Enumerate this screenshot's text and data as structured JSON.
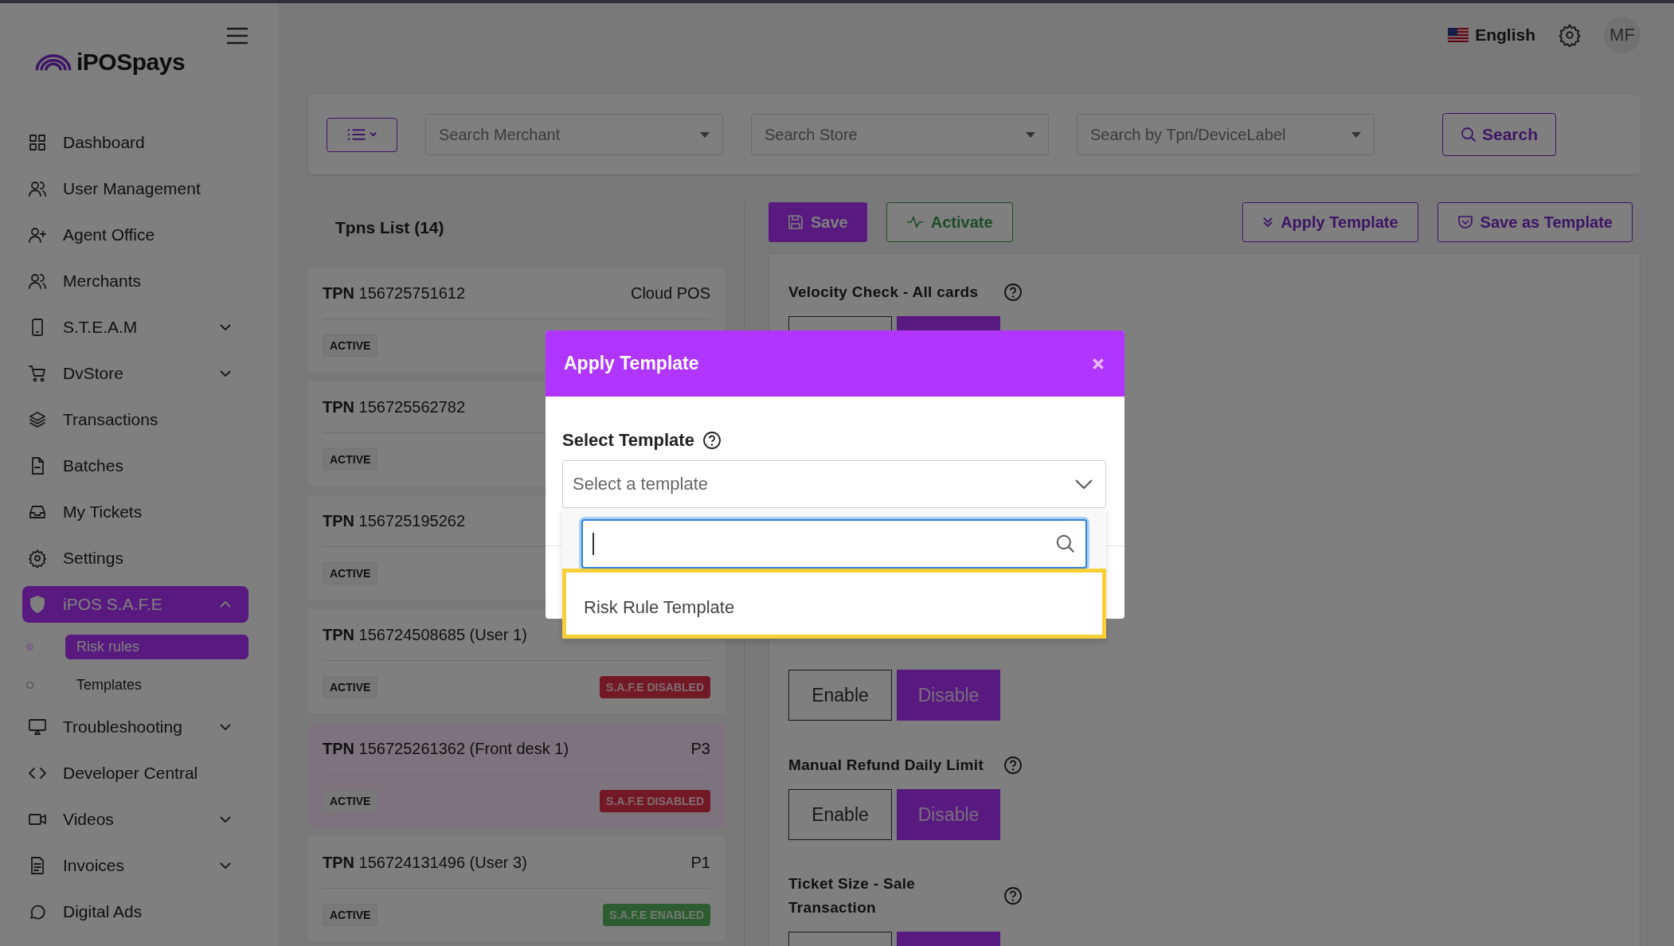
{
  "brand": {
    "name": "iPOSpays"
  },
  "header": {
    "language": "English",
    "avatar": "MF"
  },
  "sidebar": {
    "items": [
      {
        "label": "Dashboard",
        "selected": false
      },
      {
        "label": "User Management",
        "selected": false
      },
      {
        "label": "Agent Office",
        "selected": false
      },
      {
        "label": "Merchants",
        "selected": false
      },
      {
        "label": "S.T.E.A.M",
        "expanded": false,
        "selected": false
      },
      {
        "label": "DvStore",
        "expanded": false,
        "selected": false
      },
      {
        "label": "Transactions",
        "selected": false
      },
      {
        "label": "Batches",
        "selected": false
      },
      {
        "label": "My Tickets",
        "selected": false
      },
      {
        "label": "Settings",
        "selected": false
      },
      {
        "label": "iPOS S.A.F.E",
        "expanded": true,
        "selected": true,
        "children": [
          {
            "label": "Risk rules",
            "selected": true
          },
          {
            "label": "Templates",
            "selected": false
          }
        ]
      },
      {
        "label": "Troubleshooting",
        "expanded": false,
        "selected": false
      },
      {
        "label": "Developer Central",
        "selected": false
      },
      {
        "label": "Videos",
        "expanded": false,
        "selected": false
      },
      {
        "label": "Invoices",
        "expanded": false,
        "selected": false
      },
      {
        "label": "Digital Ads",
        "selected": false
      }
    ]
  },
  "filters": {
    "fields": [
      {
        "placeholder": "Search Merchant"
      },
      {
        "placeholder": "Search Store"
      },
      {
        "placeholder": "Search by Tpn/DeviceLabel"
      }
    ],
    "search_button": "Search"
  },
  "tpn_list": {
    "title": "Tpns List (14)",
    "items": [
      {
        "prefix": "TPN",
        "number": "156725751612",
        "tag": "Cloud POS",
        "status": "ACTIVE",
        "selected": false
      },
      {
        "prefix": "TPN",
        "number": "156725562782",
        "status": "ACTIVE",
        "selected": false
      },
      {
        "prefix": "TPN",
        "number": "156725195262",
        "status": "ACTIVE",
        "selected": false
      },
      {
        "prefix": "TPN",
        "number": "156724508685 (User 1)",
        "status": "ACTIVE",
        "safe": {
          "label": "S.A.F.E DISABLED",
          "kind": "disabled"
        },
        "selected": false
      },
      {
        "prefix": "TPN",
        "number": "156725261362 (Front desk 1)",
        "tag": "P3",
        "status": "ACTIVE",
        "safe": {
          "label": "S.A.F.E DISABLED",
          "kind": "disabled"
        },
        "selected": true
      },
      {
        "prefix": "TPN",
        "number": "156724131496 (User 3)",
        "tag": "P1",
        "status": "ACTIVE",
        "safe": {
          "label": "S.A.F.E ENABLED",
          "kind": "enabled"
        },
        "selected": false
      }
    ]
  },
  "toolbar": {
    "save": "Save",
    "activate": "Activate",
    "apply_template": "Apply Template",
    "save_as_template": "Save as Template"
  },
  "rules": [
    {
      "kind": "label-only",
      "label": "Velocity Check - All cards"
    },
    {
      "kind": "hidden"
    },
    {
      "kind": "hidden"
    },
    {
      "kind": "buttons-only",
      "buttons": [
        {
          "label": "Enable",
          "selected": false
        },
        {
          "label": "Disable",
          "selected": true
        }
      ]
    },
    {
      "kind": "full",
      "label": "Manual Refund Daily Limit",
      "buttons": [
        {
          "label": "Enable",
          "selected": false
        },
        {
          "label": "Disable",
          "selected": true
        }
      ]
    },
    {
      "kind": "label-only",
      "label": "Ticket Size - Sale Transaction"
    }
  ],
  "modal": {
    "title": "Apply Template",
    "field_label": "Select Template",
    "placeholder": "Select a template",
    "options": [
      {
        "label": "Risk Rule Template",
        "highlighted": true
      }
    ]
  }
}
